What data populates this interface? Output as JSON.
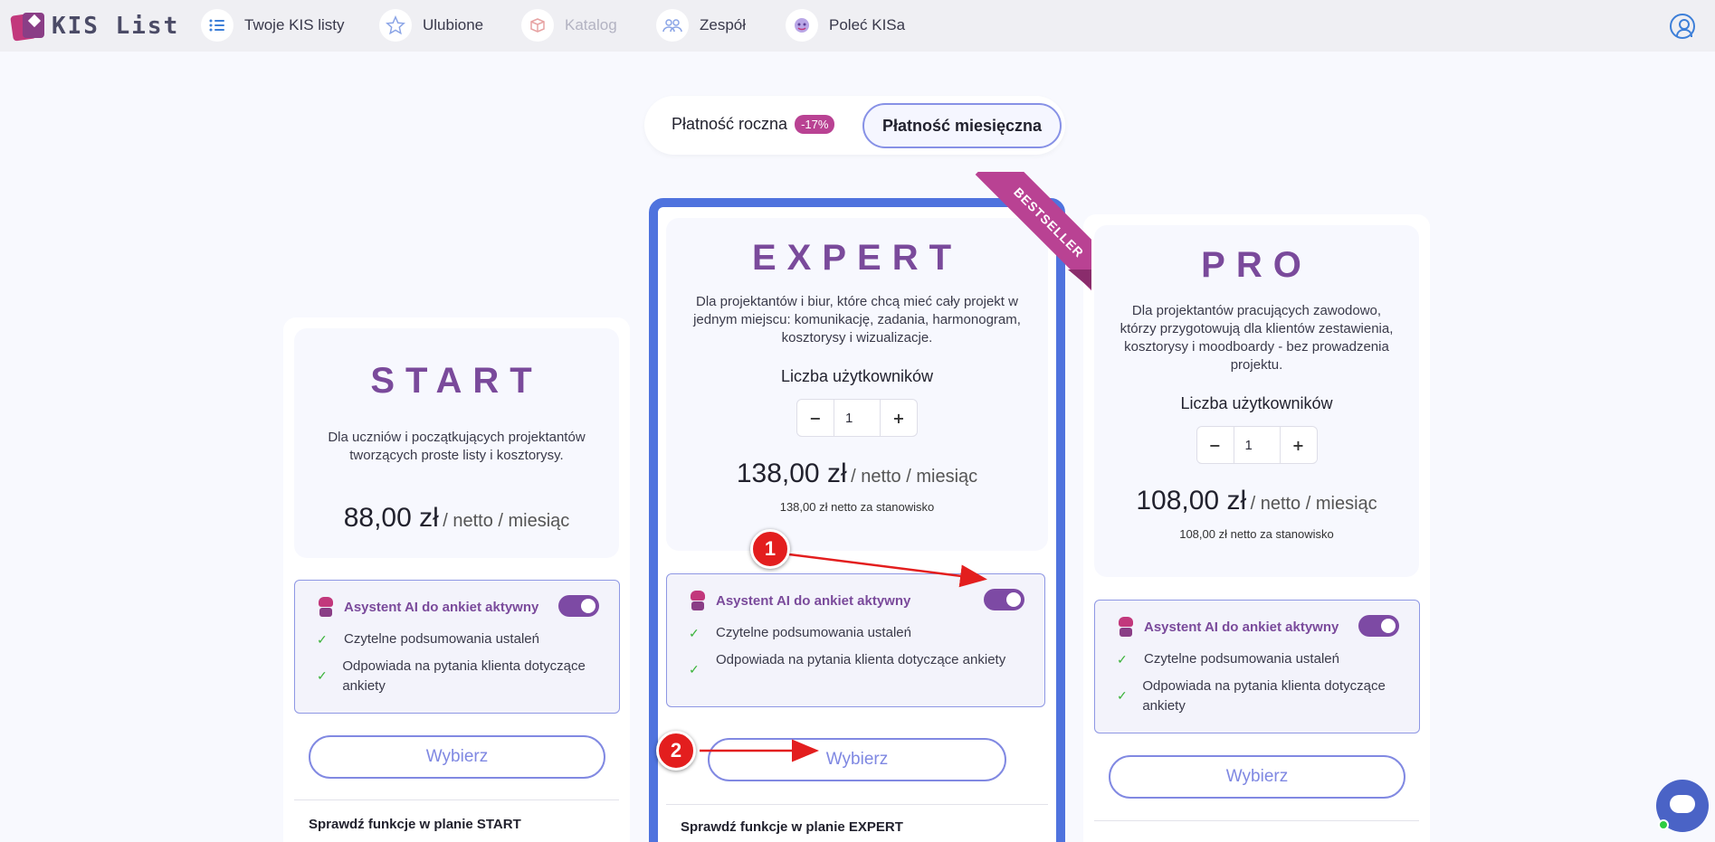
{
  "nav": {
    "logo_text": "KIS List",
    "items": [
      {
        "label": "Twoje KIS listy",
        "icon": "list-icon"
      },
      {
        "label": "Ulubione",
        "icon": "star-icon"
      },
      {
        "label": "Katalog",
        "icon": "catalog-box-icon"
      },
      {
        "label": "Zespół",
        "icon": "team-icon"
      },
      {
        "label": "Poleć KISa",
        "icon": "refer-icon"
      }
    ],
    "user_icon": "user-circle-icon"
  },
  "billing": {
    "annual_label": "Płatność roczna",
    "annual_discount": "-17%",
    "monthly_label": "Płatność miesięczna",
    "selected": "monthly"
  },
  "plans": {
    "start": {
      "name": "START",
      "description": "Dla uczniów i początkujących projektantów tworzących proste listy i kosztorysy.",
      "price": "88,00 zł",
      "price_unit": "/ netto / miesiąc",
      "ai_title": "Asystent AI do ankiet aktywny",
      "ai_enabled": true,
      "features": [
        "Czytelne podsumowania ustaleń",
        "Odpowiada na pytania klienta dotyczące ankiety"
      ],
      "choose_label": "Wybierz",
      "check_functions": "Sprawdź funkcje w planie START"
    },
    "expert": {
      "name": "EXPERT",
      "badge": "BESTSELLER",
      "description": "Dla projektantów i biur, które chcą mieć cały projekt w jednym miejscu: komunikację, zadania, harmonogram, kosztorysy i wizualizacje.",
      "users_label": "Liczba użytkowników",
      "users_value": "1",
      "price": "138,00 zł",
      "price_unit": "/ netto / miesiąc",
      "per_seat": "138,00 zł netto za stanowisko",
      "ai_title": "Asystent AI do ankiet aktywny",
      "ai_enabled": true,
      "features": [
        "Czytelne podsumowania ustaleń",
        "Odpowiada na pytania klienta dotyczące ankiety"
      ],
      "choose_label": "Wybierz",
      "check_functions": "Sprawdź funkcje w planie EXPERT"
    },
    "pro": {
      "name": "PRO",
      "description": "Dla projektantów pracujących zawodowo, którzy przygotowują dla klientów zestawienia, kosztorysy i moodboardy - bez prowadzenia projektu.",
      "users_label": "Liczba użytkowników",
      "users_value": "1",
      "price": "108,00 zł",
      "price_unit": "/ netto / miesiąc",
      "per_seat": "108,00 zł netto za stanowisko",
      "ai_title": "Asystent AI do ankiet aktywny",
      "ai_enabled": true,
      "features": [
        "Czytelne podsumowania ustaleń",
        "Odpowiada na pytania klienta dotyczące ankiety"
      ],
      "choose_label": "Wybierz"
    }
  },
  "annotations": [
    "1",
    "2"
  ],
  "stepper": {
    "minus": "−",
    "plus": "+"
  },
  "colors": {
    "accent_purple": "#7a4a9b",
    "highlight_blue": "#4f73de",
    "ribbon": "#b94293",
    "annotation_red": "#e31e1e",
    "button_border": "#8189e2"
  }
}
